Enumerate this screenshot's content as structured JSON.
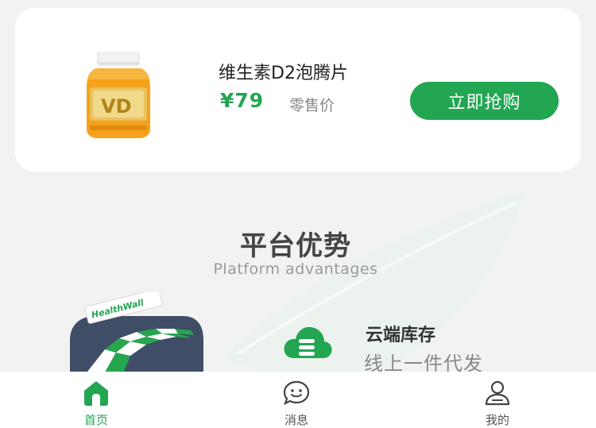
{
  "product": {
    "name": "维生素D2泡腾片",
    "price": "¥79",
    "price_type": "零售价",
    "buy_label": "立即抢购",
    "image_icon": "vitamin-bottle-icon"
  },
  "section": {
    "title": "平台优势",
    "subtitle": "Platform advantages"
  },
  "illustration": {
    "store_sign": "HealthWall"
  },
  "feature": {
    "icon": "cloud-stack-icon",
    "title": "云端库存",
    "description": "线上一件代发"
  },
  "tabbar": {
    "items": [
      {
        "label": "首页",
        "icon": "home-icon",
        "active": true
      },
      {
        "label": "消息",
        "icon": "chat-icon",
        "active": false
      },
      {
        "label": "我的",
        "icon": "user-icon",
        "active": false
      }
    ]
  },
  "colors": {
    "accent": "#22a652",
    "background": "#f2f2f2",
    "card": "#ffffff"
  }
}
